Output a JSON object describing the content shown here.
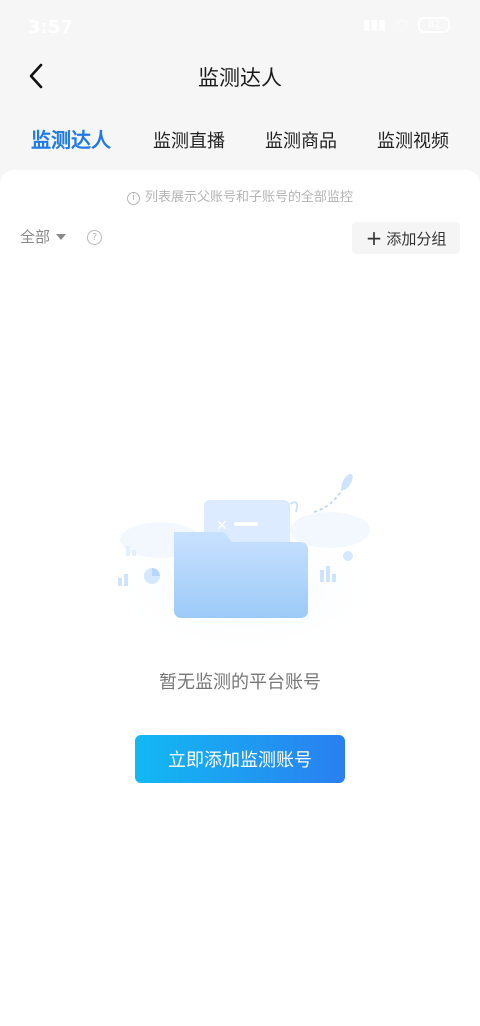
{
  "status_bar": {
    "time": "3:57",
    "battery": "82"
  },
  "nav": {
    "title": "监测达人",
    "back_icon": "chevron-left-icon"
  },
  "tabs": [
    {
      "label": "监测达人",
      "active": true
    },
    {
      "label": "监测直播",
      "active": false
    },
    {
      "label": "监测商品",
      "active": false
    },
    {
      "label": "监测视频",
      "active": false
    }
  ],
  "hint": "列表展示父账号和子账号的全部监控",
  "filter": {
    "label": "全部",
    "help_icon": "question-circle-icon"
  },
  "add_group": {
    "label": "添加分组",
    "icon": "plus-icon"
  },
  "empty_state": {
    "illustration": "empty-folder-icon",
    "text": "暂无监测的平台账号"
  },
  "cta": {
    "label": "立即添加监测账号"
  },
  "colors": {
    "accent": "#1e7ae6",
    "cta_start": "#12b9f3",
    "cta_end": "#2a7ff0"
  }
}
